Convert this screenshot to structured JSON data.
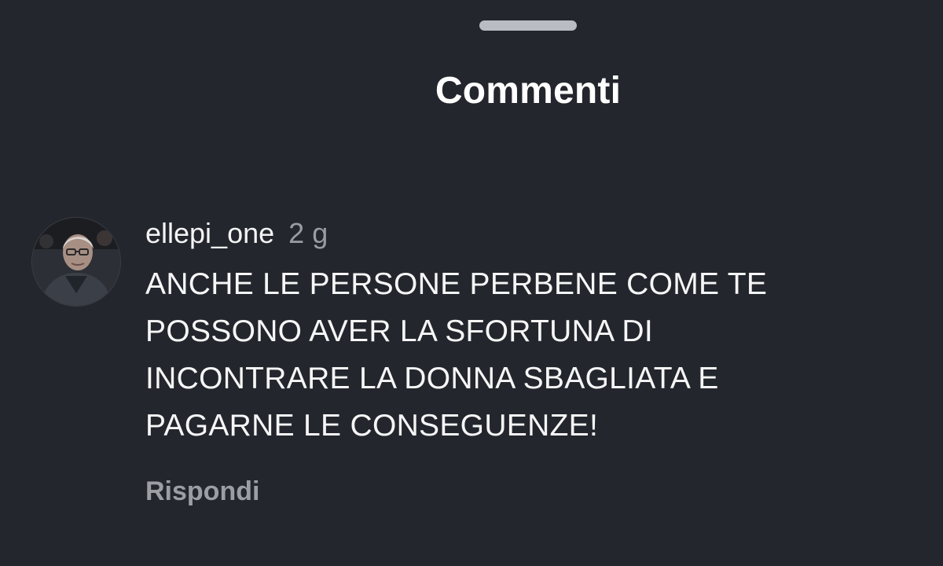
{
  "sheet": {
    "title": "Commenti"
  },
  "comment": {
    "username": "ellepi_one",
    "timestamp": "2 g",
    "lines": [
      "ANCHE LE PERSONE PERBENE COME TE",
      "POSSONO AVER LA SFORTUNA DI",
      "INCONTRARE LA DONNA SBAGLIATA E",
      "PAGARNE LE CONSEGUENZE!"
    ],
    "reply_label": "Rispondi",
    "avatar_icon": "user-photo-avatar"
  },
  "colors": {
    "background": "#23262d",
    "handle": "#b9bcc2",
    "primary_text": "#f6f6f6",
    "secondary_text": "#9c9ea3"
  }
}
